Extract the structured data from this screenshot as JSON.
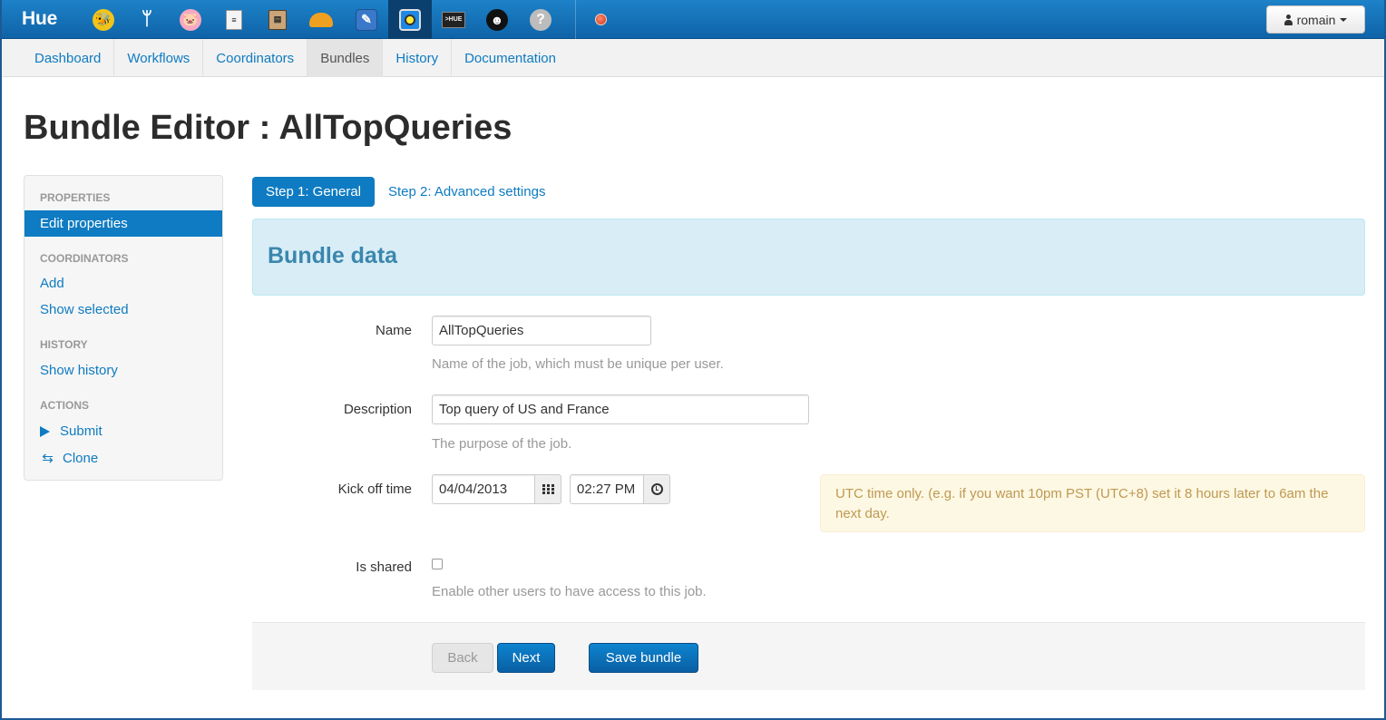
{
  "app": {
    "brand": "Hue",
    "icons": [
      "beeswax-icon",
      "oozie-icon",
      "pig-icon",
      "file-browser-icon",
      "job-browser-icon",
      "hbase-icon",
      "metastore-icon",
      "oozie-workflow-icon",
      "shell-icon",
      "user-admin-icon",
      "help-icon"
    ],
    "active_icon": "oozie-workflow-icon",
    "user": "romain"
  },
  "subnav": {
    "items": [
      "Dashboard",
      "Workflows",
      "Coordinators",
      "Bundles",
      "History",
      "Documentation"
    ],
    "active": "Bundles"
  },
  "page": {
    "title": "Bundle Editor : AllTopQueries"
  },
  "sidebar": {
    "properties_header": "PROPERTIES",
    "edit_properties": "Edit properties",
    "coordinators_header": "COORDINATORS",
    "add": "Add",
    "show_selected": "Show selected",
    "history_header": "HISTORY",
    "show_history": "Show history",
    "actions_header": "ACTIONS",
    "submit": "Submit",
    "clone": "Clone"
  },
  "steps": {
    "step1": "Step 1: General",
    "step2": "Step 2: Advanced settings"
  },
  "section": {
    "heading": "Bundle data"
  },
  "form": {
    "name_label": "Name",
    "name_value": "AllTopQueries",
    "name_help": "Name of the job, which must be unique per user.",
    "description_label": "Description",
    "description_value": "Top query of US and France",
    "description_help": "The purpose of the job.",
    "kickoff_label": "Kick off time",
    "kickoff_date": "04/04/2013",
    "kickoff_time": "02:27 PM",
    "utc_note": "UTC time only. (e.g. if you want 10pm PST (UTC+8) set it 8 hours later to 6am the next day.",
    "shared_label": "Is shared",
    "shared_checked": false,
    "shared_help": "Enable other users to have access to this job."
  },
  "actions": {
    "back": "Back",
    "next": "Next",
    "save": "Save bundle"
  }
}
